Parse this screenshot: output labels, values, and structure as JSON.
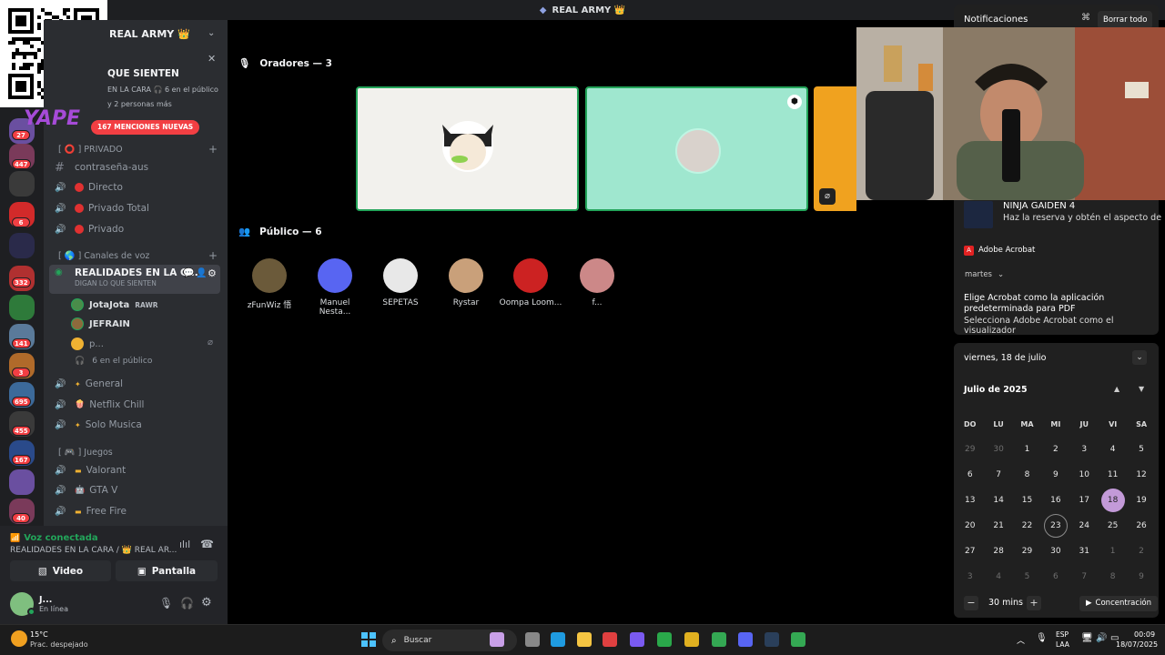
{
  "window": {
    "title": "REAL ARMY 👑"
  },
  "server": {
    "name": "REAL ARMY 👑",
    "event_title": "QUE SIENTEN",
    "event_line1": "EN LA CARA  🎧 6 en el público",
    "event_line2": "y 2 personas más",
    "yape": "YAPE",
    "mentions_badge": "167 MENCIONES NUEVAS"
  },
  "rail": {
    "badges": [
      "27",
      "447",
      "6",
      "332",
      "141",
      "3",
      "695",
      "455",
      "167",
      "40"
    ]
  },
  "categories": {
    "privado": "[ ⭕ ] PRIVADO",
    "voz": "[ 🌎 ] Canales de voz",
    "juegos": "[ 🎮 ] Juegos"
  },
  "channels": {
    "contrasena": "contraseña-aus",
    "directo": "Directo",
    "privado_total": "Privado Total",
    "privado": "Privado",
    "realidades": "REALIDADES EN LA C...",
    "realidades_sub": "DIGAN LO QUE SIENTEN",
    "general": "General",
    "netflix": "Netflix Chill",
    "solo_musica": "Solo Musica",
    "valorant": "Valorant",
    "gtav": "GTA V",
    "freefire": "Free Fire"
  },
  "voice_users": [
    {
      "name": "JotaJota",
      "tag": "RAWR"
    },
    {
      "name": "JEFRAIN",
      "tag": ""
    },
    {
      "name": "p...",
      "tag": ""
    }
  ],
  "audience_count": "6 en el público",
  "voice_panel": {
    "status": "Voz conectada",
    "location": "REALIDADES EN LA CARA / 👑 REAL AR...",
    "video": "Video",
    "screen": "Pantalla",
    "user": "J...",
    "user_status": "En línea"
  },
  "stage": {
    "speakers_header": "Oradores — 3",
    "public_header": "Público — 6",
    "public": [
      "zFunWiz 悟",
      "Manuel Nesta...",
      "SEPETAS",
      "Rystar",
      "Oompa Loom...",
      "f..."
    ]
  },
  "notifications": {
    "title": "Notificaciones",
    "clear_all": "Borrar todo",
    "ninja_title": "NINJA GAIDEN 4",
    "ninja_text": "Haz la reserva y obtén el aspecto de",
    "acrobat_app": "Adobe Acrobat",
    "acrobat_time": "martes",
    "acrobat_line1": "Elige Acrobat como la aplicación",
    "acrobat_line2": "predeterminada para PDF",
    "acrobat_line3": "Selecciona Adobe Acrobat como el visualizador"
  },
  "calendar": {
    "date_header": "viernes, 18 de julio",
    "month": "Julio de 2025",
    "weekdays": [
      "DO",
      "LU",
      "MA",
      "MI",
      "JU",
      "VI",
      "SA"
    ],
    "weeks": [
      [
        "29",
        "30",
        "1",
        "2",
        "3",
        "4",
        "5"
      ],
      [
        "6",
        "7",
        "8",
        "9",
        "10",
        "11",
        "12"
      ],
      [
        "13",
        "14",
        "15",
        "16",
        "17",
        "18",
        "19"
      ],
      [
        "20",
        "21",
        "22",
        "23",
        "24",
        "25",
        "26"
      ],
      [
        "27",
        "28",
        "29",
        "30",
        "31",
        "1",
        "2"
      ],
      [
        "3",
        "4",
        "5",
        "6",
        "7",
        "8",
        "9"
      ]
    ],
    "focus_minutes": "30 mins",
    "focus_label": "Concentración"
  },
  "taskbar": {
    "weather_temp": "15°C",
    "weather_desc": "Prac. despejado",
    "search": "Buscar",
    "lang1": "ESP",
    "lang2": "LAA",
    "time": "00:09",
    "date": "18/07/2025"
  }
}
